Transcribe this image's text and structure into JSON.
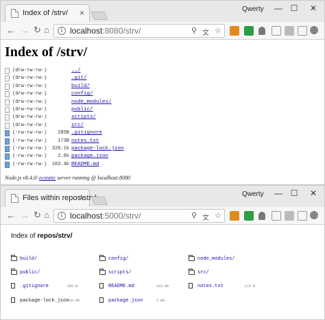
{
  "window1": {
    "tab_title": "Index of /strv/",
    "profile_name": "Qwerty",
    "url_host": "localhost",
    "url_rest": ":8080/strv/",
    "heading": "Index of /strv/",
    "entries": [
      {
        "perm": "(drw-rw-rw-)",
        "size": "",
        "name": "../",
        "kind": "dir"
      },
      {
        "perm": "(drw-rw-rw-)",
        "size": "",
        "name": ".git/",
        "kind": "dir"
      },
      {
        "perm": "(drw-rw-rw-)",
        "size": "",
        "name": "build/",
        "kind": "dir"
      },
      {
        "perm": "(drw-rw-rw-)",
        "size": "",
        "name": "config/",
        "kind": "dir"
      },
      {
        "perm": "(drw-rw-rw-)",
        "size": "",
        "name": "node_modules/",
        "kind": "dir"
      },
      {
        "perm": "(drw-rw-rw-)",
        "size": "",
        "name": "public/",
        "kind": "dir"
      },
      {
        "perm": "(drw-rw-rw-)",
        "size": "",
        "name": "scripts/",
        "kind": "dir"
      },
      {
        "perm": "(drw-rw-rw-)",
        "size": "",
        "name": "src/",
        "kind": "dir"
      },
      {
        "perm": "(-rw-rw-rw-)",
        "size": "285B",
        "name": ".gitignore",
        "kind": "file"
      },
      {
        "perm": "(-rw-rw-rw-)",
        "size": "173B",
        "name": "notes.txt",
        "kind": "file"
      },
      {
        "perm": "(-rw-rw-rw-)",
        "size": "320.1k",
        "name": "package-lock.json",
        "kind": "file"
      },
      {
        "perm": "(-rw-rw-rw-)",
        "size": "2.6k",
        "name": "package.json",
        "kind": "file"
      },
      {
        "perm": "(-rw-rw-rw-)",
        "size": "103.4k",
        "name": "README.md",
        "kind": "file"
      }
    ],
    "footer_prefix": "Node.js v8.4.0/",
    "footer_link": "ecstatic",
    "footer_suffix": "server running @ localhost:8080"
  },
  "window2": {
    "tab_title": "Files within repos\\strv\\",
    "profile_name": "Qwerty",
    "url_host": "localhost",
    "url_rest": ":5000/strv/",
    "heading_prefix": "Index of ",
    "heading_path": "repos/strv/",
    "items": [
      {
        "name": "build/",
        "size": "",
        "kind": "folder"
      },
      {
        "name": "config/",
        "size": "",
        "kind": "folder"
      },
      {
        "name": "node_modules/",
        "size": "",
        "kind": "folder"
      },
      {
        "name": "public/",
        "size": "",
        "kind": "folder"
      },
      {
        "name": "scripts/",
        "size": "",
        "kind": "folder"
      },
      {
        "name": "src/",
        "size": "",
        "kind": "folder"
      },
      {
        "name": ".gitignore",
        "size": "285 B",
        "kind": "file"
      },
      {
        "name": "README.md",
        "size": "103 KB",
        "kind": "file"
      },
      {
        "name": "notes.txt",
        "size": "173 B",
        "kind": "file"
      },
      {
        "name": "package-lock.json",
        "size": "320 KB",
        "kind": "file"
      },
      {
        "name": "package.json",
        "size": "3 KB",
        "kind": "file"
      }
    ]
  },
  "controls": {
    "minimize": "—",
    "maximize": "☐",
    "close": "✕",
    "tab_close": "×"
  },
  "colors": {
    "link": "#1a0dab",
    "ext_green": "#2e9d43",
    "ext_red": "#d2402b",
    "ext_orange": "#e08a1e"
  }
}
